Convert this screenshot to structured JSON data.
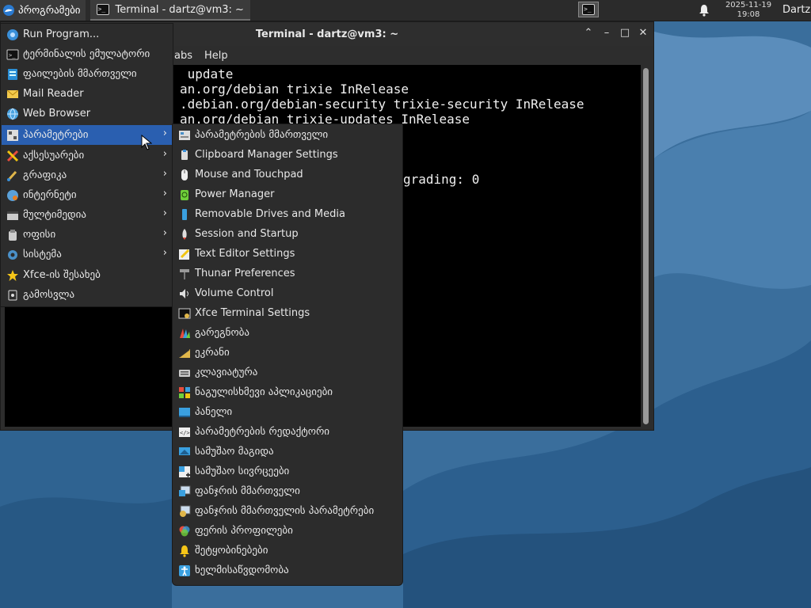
{
  "panel": {
    "apps_label": "პროგრამები",
    "task_label": "Terminal - dartz@vm3: ~",
    "clock_date": "2025-11-19",
    "clock_time": "19:08",
    "user": "Dartz"
  },
  "window": {
    "title": "Terminal - dartz@vm3: ~",
    "menu_tabs": "abs",
    "menu_help": "Help",
    "lines": [
      " update",
      "an.org/debian trixie InRelease",
      ".debian.org/debian-security trixie-security InRelease",
      "an.org/debian trixie-updates InRelease",
      "grading: 0"
    ]
  },
  "menu": {
    "items": [
      {
        "label": "Run Program...",
        "icon": "run-icon"
      },
      {
        "label": "ტერმინალის ემულატორი",
        "icon": "terminal-icon"
      },
      {
        "label": "ფაილების მმართველი",
        "icon": "file-manager-icon"
      },
      {
        "label": "Mail Reader",
        "icon": "mail-icon"
      },
      {
        "label": "Web Browser",
        "icon": "globe-icon"
      },
      {
        "label": "პარამეტრები",
        "icon": "settings-icon",
        "submenu": true
      },
      {
        "label": "აქსესუარები",
        "icon": "accessories-icon",
        "submenu": true
      },
      {
        "label": "გრაფიკა",
        "icon": "graphics-icon",
        "submenu": true
      },
      {
        "label": "ინტერნეტი",
        "icon": "internet-icon",
        "submenu": true
      },
      {
        "label": "მულტიმედია",
        "icon": "multimedia-icon",
        "submenu": true
      },
      {
        "label": "ოფისი",
        "icon": "office-icon",
        "submenu": true
      },
      {
        "label": "სისტემა",
        "icon": "system-icon",
        "submenu": true
      },
      {
        "label": "Xfce-ის შესახებ",
        "icon": "star-icon"
      },
      {
        "label": "გამოსვლა",
        "icon": "logout-icon"
      }
    ]
  },
  "submenu": {
    "items": [
      {
        "label": "პარამეტრების მმართველი",
        "icon": "settings-manager-icon"
      },
      {
        "label": "Clipboard Manager Settings",
        "icon": "clipboard-icon"
      },
      {
        "label": "Mouse and Touchpad",
        "icon": "mouse-icon"
      },
      {
        "label": "Power Manager",
        "icon": "power-icon"
      },
      {
        "label": "Removable Drives and Media",
        "icon": "drive-icon"
      },
      {
        "label": "Session and Startup",
        "icon": "rocket-icon"
      },
      {
        "label": "Text Editor Settings",
        "icon": "text-editor-icon"
      },
      {
        "label": "Thunar Preferences",
        "icon": "hammer-icon"
      },
      {
        "label": "Volume Control",
        "icon": "speaker-icon"
      },
      {
        "label": "Xfce Terminal Settings",
        "icon": "terminal-settings-icon"
      },
      {
        "label": "გარეგნობა",
        "icon": "appearance-icon"
      },
      {
        "label": "ეკრანი",
        "icon": "display-icon"
      },
      {
        "label": "კლავიატურა",
        "icon": "keyboard-icon"
      },
      {
        "label": "ნაგულისხმევი აპლიკაციები",
        "icon": "default-apps-icon"
      },
      {
        "label": "პანელი",
        "icon": "panel-icon"
      },
      {
        "label": "პარამეტრების რედაქტორი",
        "icon": "settings-editor-icon"
      },
      {
        "label": "სამუშაო მაგიდა",
        "icon": "desktop-icon"
      },
      {
        "label": "სამუშაო სივრცეები",
        "icon": "workspaces-icon"
      },
      {
        "label": "ფანჯრის მმართველი",
        "icon": "window-manager-icon"
      },
      {
        "label": "ფანჯრის მმართველის პარამეტრები",
        "icon": "wm-tweaks-icon"
      },
      {
        "label": "ფერის პროფილები",
        "icon": "color-profiles-icon"
      },
      {
        "label": "შეტყობინებები",
        "icon": "bell-icon"
      },
      {
        "label": "ხელმისაწვდომობა",
        "icon": "accessibility-icon"
      }
    ]
  }
}
